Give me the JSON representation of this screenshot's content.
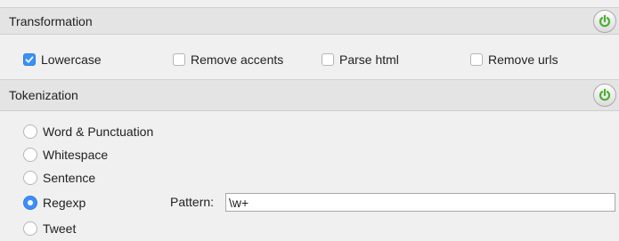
{
  "transformation": {
    "title": "Transformation",
    "options": [
      {
        "label": "Lowercase",
        "checked": true
      },
      {
        "label": "Remove accents",
        "checked": false
      },
      {
        "label": "Parse html",
        "checked": false
      },
      {
        "label": "Remove urls",
        "checked": false
      }
    ],
    "power_icon": "power-icon",
    "power_color": "#4caf32"
  },
  "tokenization": {
    "title": "Tokenization",
    "methods": [
      {
        "label": "Word & Punctuation",
        "selected": false
      },
      {
        "label": "Whitespace",
        "selected": false
      },
      {
        "label": "Sentence",
        "selected": false
      },
      {
        "label": "Regexp",
        "selected": true
      },
      {
        "label": "Tweet",
        "selected": false
      }
    ],
    "pattern_label": "Pattern:",
    "pattern_value": "\\w+",
    "power_icon": "power-icon",
    "power_color": "#4caf32"
  }
}
